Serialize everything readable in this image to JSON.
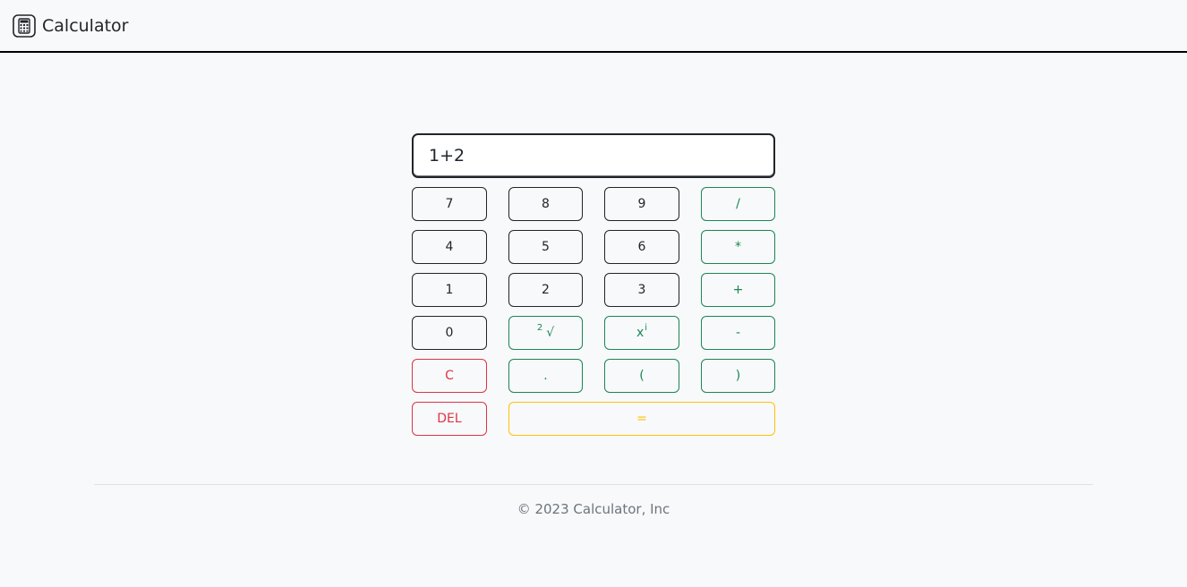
{
  "navbar": {
    "brand_text": "Calculator",
    "brand_icon": "calculator-icon"
  },
  "display": {
    "value": "1+2"
  },
  "keypad": {
    "seven": "7",
    "eight": "8",
    "nine": "9",
    "divide": "/",
    "four": "4",
    "five": "5",
    "six": "6",
    "multiply": "*",
    "one": "1",
    "two": "2",
    "three": "3",
    "add": "+",
    "zero": "0",
    "sqrt_sup": "2",
    "sqrt_symbol": "√",
    "power_base": "x",
    "power_sup": "i",
    "subtract": "-",
    "clear": "C",
    "dot": ".",
    "open_paren": "(",
    "close_paren": ")",
    "delete": "DEL",
    "equals": "="
  },
  "footer": {
    "copyright": "© 2023 Calculator, Inc"
  },
  "colors": {
    "dark": "#212529",
    "green": "#198754",
    "red": "#dc3545",
    "yellow": "#ffc107",
    "background": "#f8f9fa"
  }
}
